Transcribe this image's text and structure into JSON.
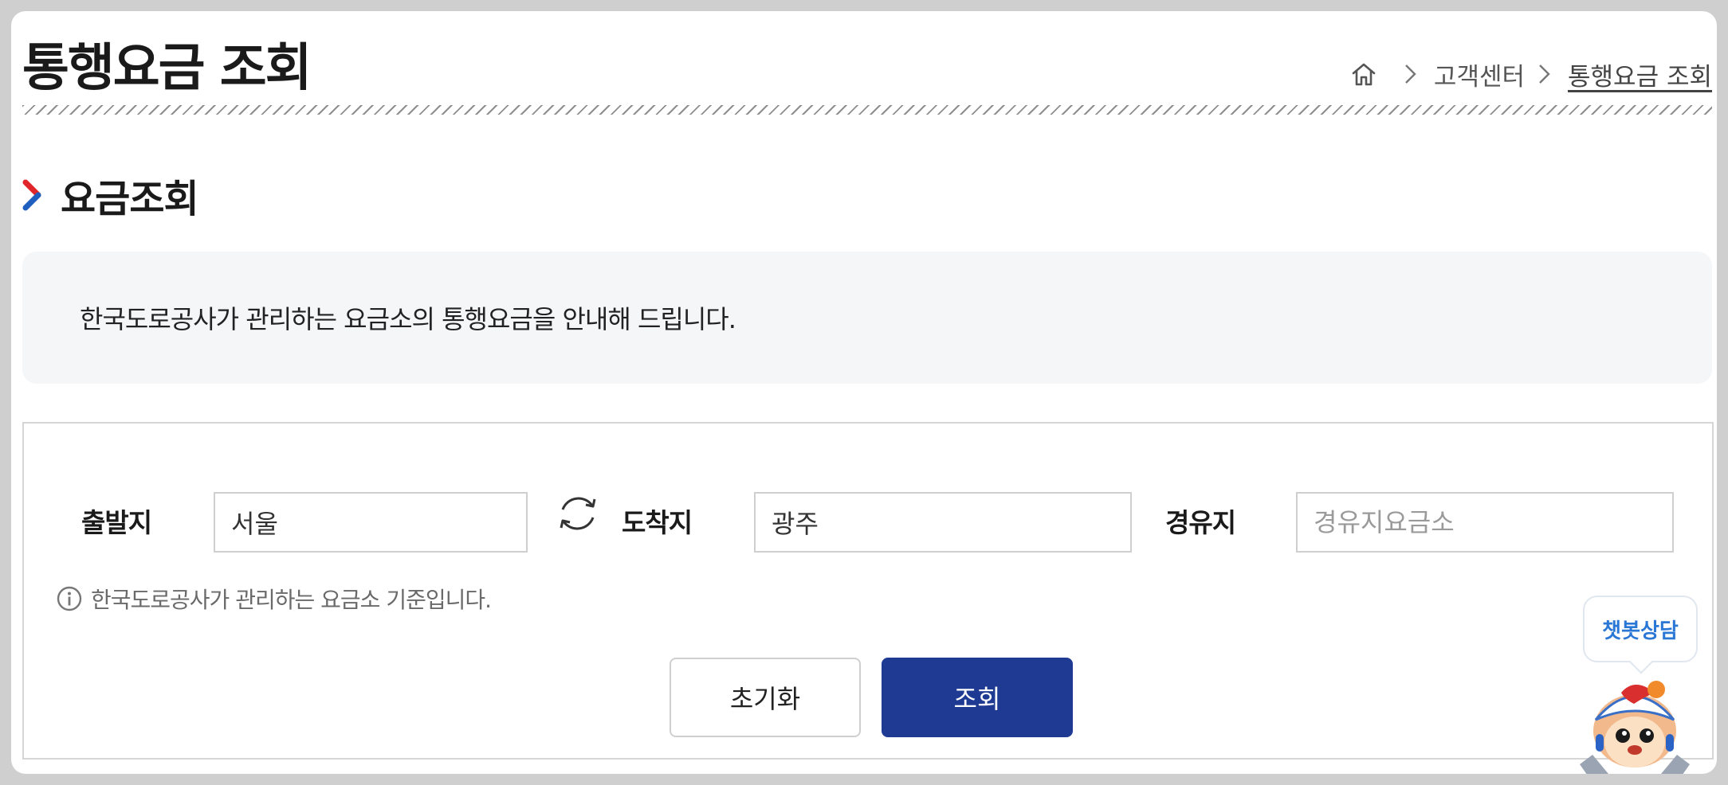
{
  "header": {
    "title": "통행요금 조회",
    "breadcrumb": {
      "home_icon": "home-icon",
      "items": [
        "고객센터",
        "통행요금 조회"
      ]
    }
  },
  "section": {
    "title": "요금조회"
  },
  "info": {
    "text": "한국도로공사가 관리하는 요금소의 통행요금을 안내해 드립니다."
  },
  "search": {
    "origin_label": "출발지",
    "origin_value": "서울",
    "destination_label": "도착지",
    "destination_value": "광주",
    "via_label": "경유지",
    "via_placeholder": "경유지요금소",
    "note": "한국도로공사가 관리하는 요금소 기준입니다.",
    "reset_label": "초기화",
    "search_label": "조회"
  },
  "chatbot": {
    "label": "챗봇상담"
  },
  "colors": {
    "primary": "#1f3a93",
    "accent_red": "#e0262b",
    "accent_blue": "#1f5fbf",
    "chatbot_text": "#2b77d6"
  }
}
